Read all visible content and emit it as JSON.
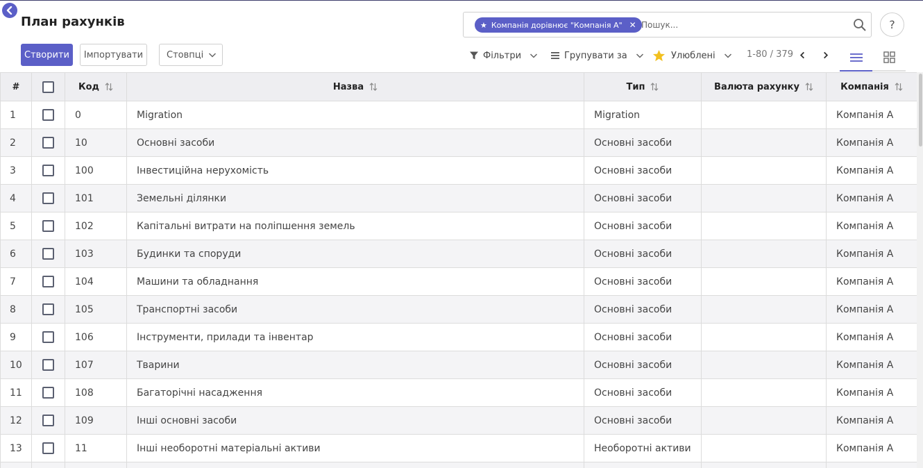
{
  "header": {
    "title": "План рахунків"
  },
  "actions": {
    "create": "Створити",
    "import": "Імпортувати",
    "columns": "Стовпці"
  },
  "search": {
    "facet": "Компанія дорівнює \"Компанія А\"",
    "placeholder": "Пошук..."
  },
  "help": {
    "label": "?"
  },
  "toolbar": {
    "filters": "Фільтри",
    "group_by": "Групувати за",
    "favorites": "Улюблені",
    "pager": "1-80 / 379"
  },
  "colors": {
    "accent": "#5b5fc7",
    "star": "#f2c01f"
  },
  "table": {
    "headers": {
      "index": "#",
      "code": "Код",
      "name": "Назва",
      "type": "Тип",
      "currency": "Валюта рахунку",
      "company": "Компанія"
    },
    "rows": [
      {
        "n": "1",
        "code": "0",
        "name": "Migration",
        "type": "Migration",
        "currency": "",
        "company": "Компанія А"
      },
      {
        "n": "2",
        "code": "10",
        "name": "Основні засоби",
        "type": "Основні засоби",
        "currency": "",
        "company": "Компанія А"
      },
      {
        "n": "3",
        "code": "100",
        "name": "Інвестиційна нерухомість",
        "type": "Основні засоби",
        "currency": "",
        "company": "Компанія А"
      },
      {
        "n": "4",
        "code": "101",
        "name": "Земельні ділянки",
        "type": "Основні засоби",
        "currency": "",
        "company": "Компанія А"
      },
      {
        "n": "5",
        "code": "102",
        "name": "Капітальні витрати на поліпшення земель",
        "type": "Основні засоби",
        "currency": "",
        "company": "Компанія А"
      },
      {
        "n": "6",
        "code": "103",
        "name": "Будинки та споруди",
        "type": "Основні засоби",
        "currency": "",
        "company": "Компанія А"
      },
      {
        "n": "7",
        "code": "104",
        "name": "Машини та обладнання",
        "type": "Основні засоби",
        "currency": "",
        "company": "Компанія А"
      },
      {
        "n": "8",
        "code": "105",
        "name": "Транспортні засоби",
        "type": "Основні засоби",
        "currency": "",
        "company": "Компанія А"
      },
      {
        "n": "9",
        "code": "106",
        "name": "Інструменти, прилади та інвентар",
        "type": "Основні засоби",
        "currency": "",
        "company": "Компанія А"
      },
      {
        "n": "10",
        "code": "107",
        "name": "Тварини",
        "type": "Основні засоби",
        "currency": "",
        "company": "Компанія А"
      },
      {
        "n": "11",
        "code": "108",
        "name": "Багаторічні насадження",
        "type": "Основні засоби",
        "currency": "",
        "company": "Компанія А"
      },
      {
        "n": "12",
        "code": "109",
        "name": "Інші основні засоби",
        "type": "Основні засоби",
        "currency": "",
        "company": "Компанія А"
      },
      {
        "n": "13",
        "code": "11",
        "name": "Інші необоротні матеріальні активи",
        "type": "Необоротні активи",
        "currency": "",
        "company": "Компанія А"
      },
      {
        "n": "",
        "code": "",
        "name": "",
        "type": "",
        "currency": "",
        "company": ""
      }
    ]
  }
}
